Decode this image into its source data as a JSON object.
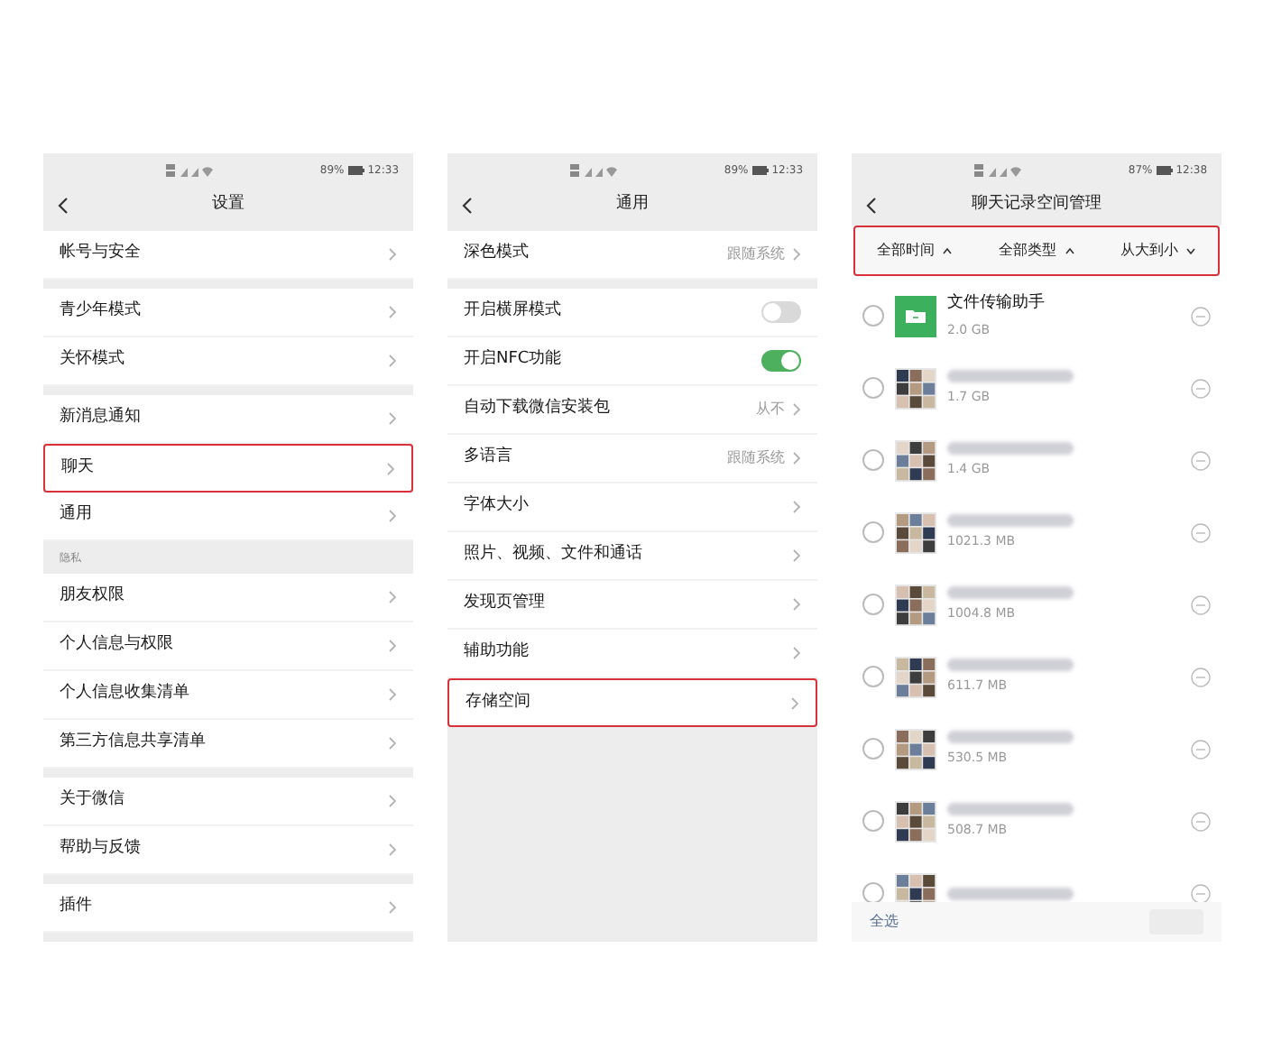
{
  "panels": [
    {
      "kind": "settings",
      "status": {
        "battery": "89%",
        "time": "12:33"
      },
      "title": "设置",
      "groups": [
        {
          "items": [
            {
              "label": "帐号与安全",
              "kind": "link",
              "highlighted": false
            }
          ]
        },
        {
          "items": [
            {
              "label": "青少年模式",
              "kind": "link",
              "highlighted": false
            },
            {
              "label": "关怀模式",
              "kind": "link",
              "highlighted": false
            }
          ]
        },
        {
          "items": [
            {
              "label": "新消息通知",
              "kind": "link",
              "highlighted": false
            },
            {
              "label": "聊天",
              "kind": "link",
              "highlighted": true
            },
            {
              "label": "通用",
              "kind": "link",
              "highlighted": false
            }
          ]
        },
        {
          "heading": "隐私",
          "items": [
            {
              "label": "朋友权限",
              "kind": "link",
              "highlighted": false
            },
            {
              "label": "个人信息与权限",
              "kind": "link",
              "highlighted": false
            },
            {
              "label": "个人信息收集清单",
              "kind": "link",
              "highlighted": false
            },
            {
              "label": "第三方信息共享清单",
              "kind": "link",
              "highlighted": false
            }
          ]
        },
        {
          "items": [
            {
              "label": "关于微信",
              "kind": "link",
              "highlighted": false
            },
            {
              "label": "帮助与反馈",
              "kind": "link",
              "highlighted": false
            }
          ]
        },
        {
          "items": [
            {
              "label": "插件",
              "kind": "link",
              "highlighted": false
            }
          ]
        }
      ]
    },
    {
      "kind": "settings",
      "status": {
        "battery": "89%",
        "time": "12:33"
      },
      "title": "通用",
      "groups": [
        {
          "items": [
            {
              "label": "深色模式",
              "value": "跟随系统",
              "kind": "link",
              "highlighted": false
            }
          ]
        },
        {
          "items": [
            {
              "label": "开启横屏模式",
              "kind": "toggle",
              "on": false,
              "highlighted": false
            },
            {
              "label": "开启NFC功能",
              "kind": "toggle",
              "on": true,
              "highlighted": false
            },
            {
              "label": "自动下载微信安装包",
              "value": "从不",
              "kind": "link",
              "highlighted": false
            },
            {
              "label": "多语言",
              "value": "跟随系统",
              "kind": "link",
              "highlighted": false
            },
            {
              "label": "字体大小",
              "kind": "link",
              "highlighted": false
            },
            {
              "label": "照片、视频、文件和通话",
              "kind": "link",
              "highlighted": false
            },
            {
              "label": "发现页管理",
              "kind": "link",
              "highlighted": false
            },
            {
              "label": "辅助功能",
              "kind": "link",
              "highlighted": false
            },
            {
              "label": "存储空间",
              "kind": "link",
              "highlighted": true
            }
          ]
        }
      ]
    },
    {
      "kind": "storage",
      "status": {
        "battery": "87%",
        "time": "12:38"
      },
      "title": "聊天记录空间管理",
      "filters_highlighted": true,
      "filters": [
        {
          "label": "全部时间",
          "expanded": true
        },
        {
          "label": "全部类型",
          "expanded": true
        },
        {
          "label": "从大到小",
          "expanded": false
        }
      ],
      "chats": [
        {
          "kind": "file_helper",
          "name": "文件传输助手",
          "size": "2.0 GB",
          "selected": false
        },
        {
          "kind": "group",
          "size": "1.7 GB",
          "selected": false
        },
        {
          "kind": "group",
          "size": "1.4 GB",
          "selected": false
        },
        {
          "kind": "group",
          "size": "1021.3 MB",
          "selected": false
        },
        {
          "kind": "group",
          "size": "1004.8 MB",
          "selected": false
        },
        {
          "kind": "group",
          "size": "611.7 MB",
          "selected": false
        },
        {
          "kind": "group",
          "size": "530.5 MB",
          "selected": false
        },
        {
          "kind": "group",
          "size": "508.7 MB",
          "selected": false
        },
        {
          "kind": "group",
          "selected": false
        }
      ],
      "select_all": "全选"
    }
  ]
}
